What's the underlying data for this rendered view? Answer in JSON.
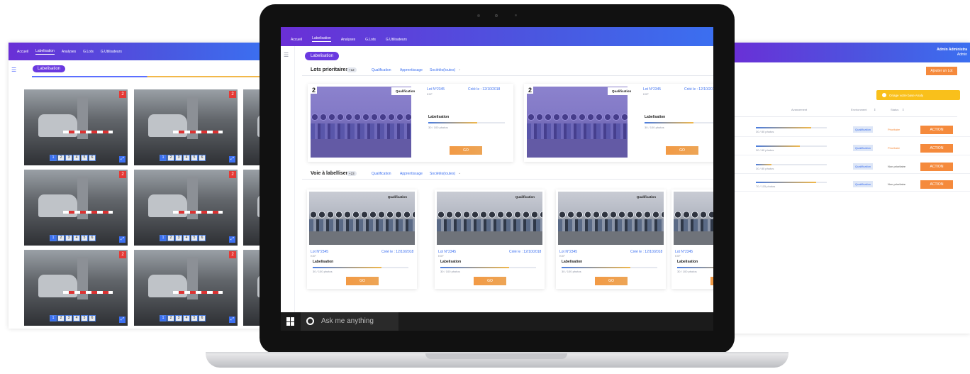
{
  "nav": {
    "items": [
      "Accueil",
      "Labelisation",
      "Analyses",
      "G.Lots",
      "G.Utilisateurs"
    ],
    "active": "Labelisation"
  },
  "page_pill": "Labelisation",
  "left": {
    "badge": "2",
    "pages": [
      "1",
      "2",
      "3",
      "4",
      "5",
      "6"
    ]
  },
  "sections": {
    "prio": {
      "title": "Lots prioritaires",
      "count": "+12"
    },
    "voie": {
      "title": "Voie à labelliser",
      "count": "+23"
    },
    "tabs": [
      "Qualification",
      "Apprentissage",
      "Sociétés(toutes)"
    ]
  },
  "card": {
    "number": "2",
    "tag": "Qualification",
    "lot": "Lot N°2345",
    "lot_sub": "KXF",
    "created": "Créé le : 12/10/2018",
    "stage": "Labelisation",
    "progress_text": "30 / 100 photos",
    "go": "GO"
  },
  "right": {
    "admin_name": "Admin Administra",
    "admin_role": "Admin",
    "add_button": "Ajouter un Lot",
    "notice": "Oriage votre base Analy",
    "headers": [
      "Avancement",
      "Environment",
      "Status"
    ],
    "rows": [
      {
        "progress": "30 / 80 photos",
        "env": "Qualification",
        "status": "Prioritaire",
        "action": "ACTION",
        "fill": 0.78
      },
      {
        "progress": "30 / 80 photos",
        "env": "Qualification",
        "status": "Prioritaire",
        "action": "ACTION",
        "fill": 0.62
      },
      {
        "progress": "30 / 80 photos",
        "env": "Qualification",
        "status": "Non prioritaire",
        "action": "ACTION",
        "fill": 0.22
      },
      {
        "progress": "70 / 115 photos",
        "env": "Qualification",
        "status": "Non prioritaire",
        "action": "ACTION",
        "fill": 0.85
      }
    ]
  },
  "taskbar": {
    "search": "Ask me anything"
  },
  "colors": {
    "accent": "#3b6ff0",
    "purple": "#6a2fd6",
    "orange": "#f58a3c",
    "yellow": "#f9c01b"
  }
}
